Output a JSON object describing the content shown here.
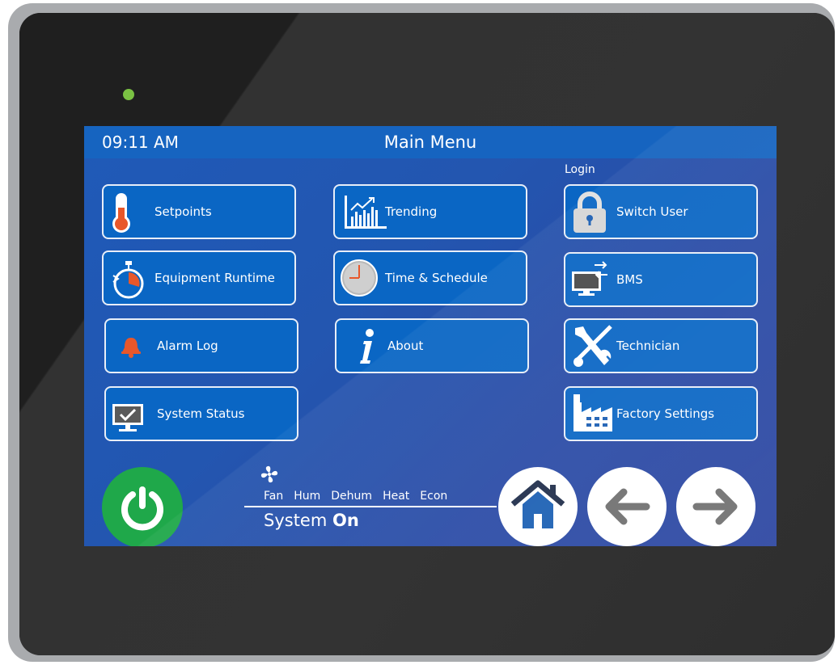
{
  "header": {
    "time": "09:11 AM",
    "title": "Main Menu"
  },
  "login_label": "Login",
  "menu": {
    "setpoints": "Setpoints",
    "equipment_runtime": "Equipment Runtime",
    "alarm_log": "Alarm Log",
    "system_status": "System Status",
    "trending": "Trending",
    "time_schedule": "Time & Schedule",
    "about": "About",
    "switch_user": "Switch User",
    "bms": "BMS",
    "technician": "Technician",
    "factory_settings": "Factory Settings"
  },
  "status": {
    "modes": [
      "Fan",
      "Hum",
      "Dehum",
      "Heat",
      "Econ"
    ],
    "system_label": "System",
    "system_state": "On"
  },
  "colors": {
    "led": "#7ac143",
    "power": "#1fa84a",
    "accent": "#e8572a",
    "button": "#0a66c4",
    "nav_icon": "#1b5fb3"
  },
  "icons": [
    "thermometer-icon",
    "stopwatch-icon",
    "bell-icon",
    "monitor-check-icon",
    "chart-icon",
    "clock-icon",
    "info-icon",
    "lock-icon",
    "monitor-arrows-icon",
    "tools-icon",
    "factory-icon",
    "fan-icon",
    "power-icon",
    "home-icon",
    "back-arrow-icon",
    "forward-arrow-icon"
  ]
}
